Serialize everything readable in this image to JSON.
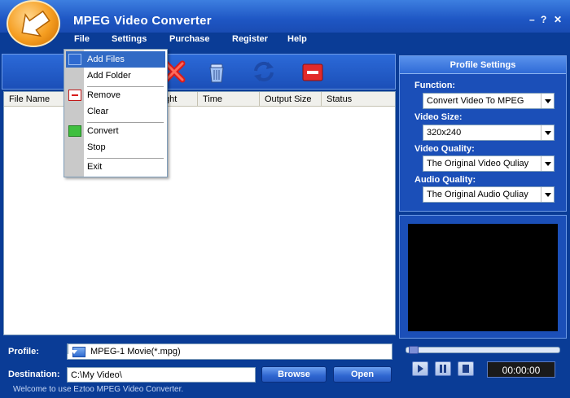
{
  "app": {
    "title": "MPEG Video Converter"
  },
  "window_controls": {
    "minimize": "–",
    "help": "?",
    "close": "✕"
  },
  "menubar": {
    "file": "File",
    "settings": "Settings",
    "purchase": "Purchase",
    "register": "Register",
    "help": "Help"
  },
  "file_menu": {
    "items": [
      "Add Files",
      "Add Folder",
      "Remove",
      "Clear",
      "Convert",
      "Stop",
      "Exit"
    ],
    "highlighted": "Add Files"
  },
  "toolbar": {
    "icons": [
      "delete-icon",
      "trash-icon",
      "refresh-icon",
      "stop-icon"
    ]
  },
  "file_list": {
    "columns": [
      "File Name",
      "Length",
      "Time",
      "Output Size",
      "Status"
    ],
    "visible_length_fragment": "ght"
  },
  "profile_settings": {
    "title": "Profile Settings",
    "function_label": "Function:",
    "function_value": "Convert Video To MPEG",
    "video_size_label": "Video Size:",
    "video_size_value": "320x240",
    "video_quality_label": "Video Quality:",
    "video_quality_value": "The Original Video Quliay",
    "audio_quality_label": "Audio Quality:",
    "audio_quality_value": "The Original Audio Quliay"
  },
  "player": {
    "time": "00:00:00",
    "seek_fraction": 0.0
  },
  "bottom": {
    "profile_label": "Profile:",
    "profile_value": "MPEG-1 Movie(*.mpg)",
    "destination_label": "Destination:",
    "destination_value": "C:\\My Video\\",
    "browse_label": "Browse",
    "open_label": "Open"
  },
  "status": "Welcome to use Eztoo MPEG Video Converter.",
  "colors": {
    "background": "#0a3c96",
    "accent": "#316ac5",
    "logo": "#f59d20"
  }
}
